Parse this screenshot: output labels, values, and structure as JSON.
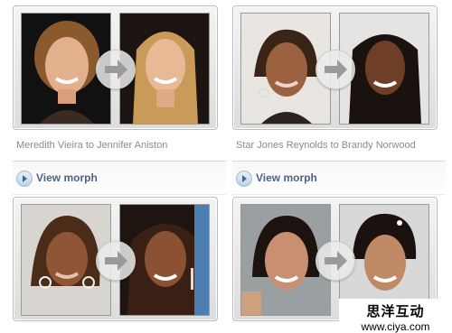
{
  "cards": [
    {
      "caption": "Meredith Vieira to Jennifer Aniston",
      "link_label": "View morph"
    },
    {
      "caption": "Star Jones Reynolds to Brandy Norwood",
      "link_label": "View morph"
    },
    {
      "caption": "",
      "link_label": ""
    },
    {
      "caption": "",
      "link_label": ""
    }
  ],
  "icons": {
    "arrow": "right-arrow-icon",
    "play": "play-icon"
  },
  "colors": {
    "link": "#4a6483",
    "caption": "#8a8a8a",
    "frame": "#dcdcdc"
  },
  "watermark": {
    "chinese": "思洋互动",
    "url": "www.ciya.com"
  }
}
